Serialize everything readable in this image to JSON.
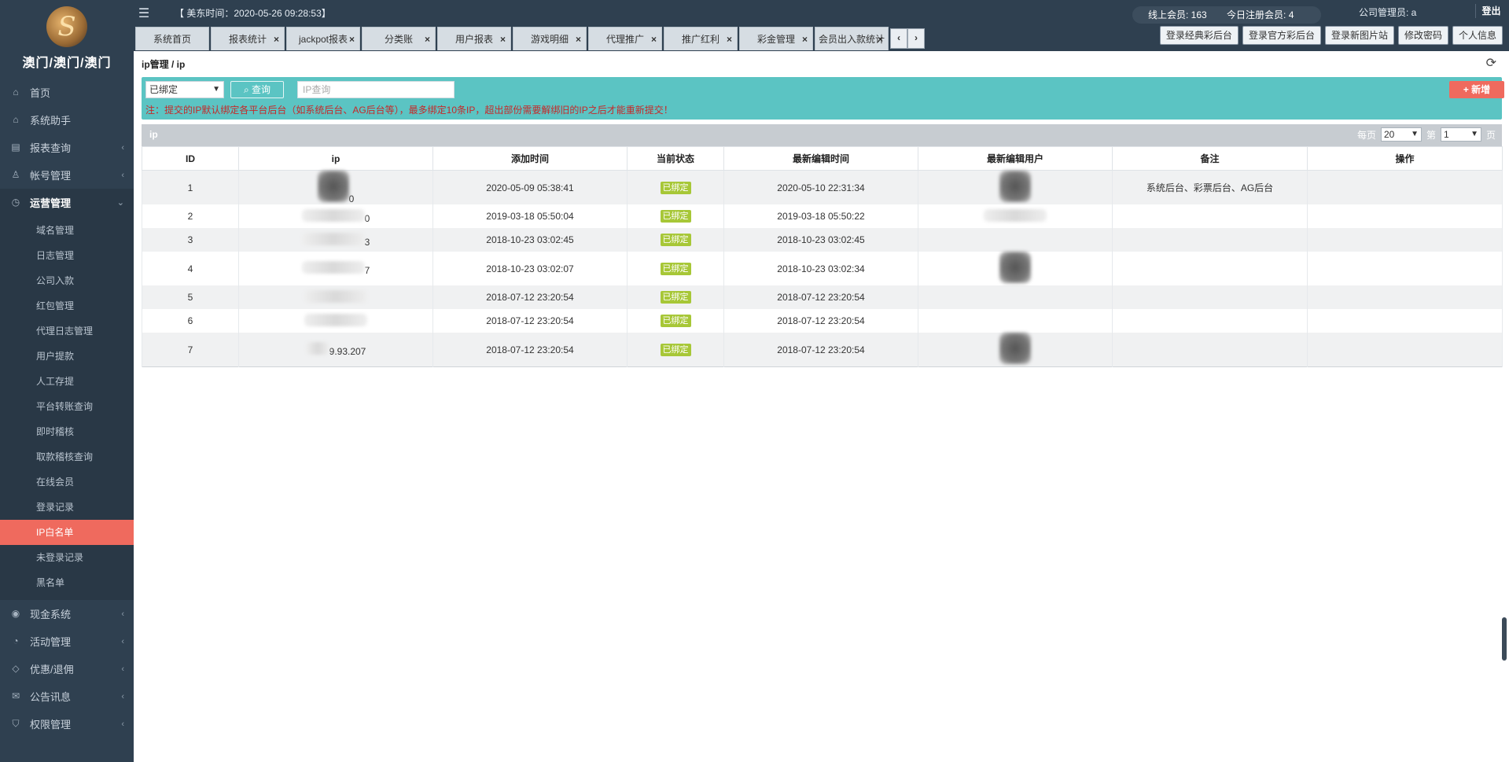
{
  "sidebar": {
    "logo_text": "澳门/澳门/澳门",
    "items": [
      {
        "label": "首页",
        "icon": "home-icon",
        "has_children": false
      },
      {
        "label": "系统助手",
        "icon": "home-icon",
        "has_children": false
      },
      {
        "label": "报表查询",
        "icon": "report-icon",
        "has_children": true
      },
      {
        "label": "帐号管理",
        "icon": "user-icon",
        "has_children": true
      },
      {
        "label": "运营管理",
        "icon": "clock-icon",
        "has_children": true,
        "open": true
      }
    ],
    "sub_items": [
      "域名管理",
      "日志管理",
      "公司入款",
      "红包管理",
      "代理日志管理",
      "用户提款",
      "人工存提",
      "平台转账查询",
      "即时稽核",
      "取款稽核查询",
      "在线会员",
      "登录记录",
      "IP白名单",
      "未登录记录",
      "黑名单"
    ],
    "active_sub": "IP白名单",
    "bottom_items": [
      {
        "label": "现金系统",
        "icon": "coin-icon"
      },
      {
        "label": "活动管理",
        "icon": "pie-icon"
      },
      {
        "label": "优惠/退佣",
        "icon": "tag-icon"
      },
      {
        "label": "公告讯息",
        "icon": "mail-icon"
      },
      {
        "label": "权限管理",
        "icon": "shield-icon"
      }
    ]
  },
  "header": {
    "clock": "【 美东时间：2020-05-26 09:28:53】",
    "online_members": "线上会员: 163",
    "today_registered": "今日注册会员: 4",
    "admin_label": "公司管理员: a",
    "logout": "登出",
    "tabs": [
      {
        "label": "系统首页",
        "closable": false
      },
      {
        "label": "报表统计",
        "closable": true
      },
      {
        "label": "jackpot报表",
        "closable": true
      },
      {
        "label": "分类账",
        "closable": true
      },
      {
        "label": "用户报表",
        "closable": true
      },
      {
        "label": "游戏明细",
        "closable": true
      },
      {
        "label": "代理推广",
        "closable": true
      },
      {
        "label": "推广红利",
        "closable": true
      },
      {
        "label": "彩金管理",
        "closable": true
      },
      {
        "label": "会员出入款统计",
        "closable": true
      }
    ],
    "actions": [
      "登录经典彩后台",
      "登录官方彩后台",
      "登录新图片站",
      "修改密码",
      "个人信息"
    ]
  },
  "main": {
    "breadcrumb": "ip管理 / ip",
    "filter": {
      "status_value": "已绑定",
      "search_label": "查询",
      "ip_placeholder": "IP查询",
      "add_label": "新增",
      "note": "注：提交的IP默认绑定各平台后台（如系统后台、AG后台等），最多绑定10条IP，超出部份需要解绑旧的IP之后才能重新提交！"
    },
    "table": {
      "caption": "ip",
      "per_page_label": "每页",
      "per_page_value": "20",
      "page_label_before": "第",
      "page_value": "1",
      "page_label_after": "页",
      "columns": [
        "ID",
        "ip",
        "添加时间",
        "当前状态",
        "最新编辑时间",
        "最新编辑用户",
        "备注",
        "操作"
      ],
      "rows": [
        {
          "id": "1",
          "ip": "0",
          "added": "2020-05-09 05:38:41",
          "status": "已绑定",
          "edited": "2020-05-10 22:31:34",
          "note": "系统后台、彩票后台、AG后台"
        },
        {
          "id": "2",
          "ip": "0",
          "added": "2019-03-18 05:50:04",
          "status": "已绑定",
          "edited": "2019-03-18 05:50:22",
          "note": ""
        },
        {
          "id": "3",
          "ip": "3",
          "added": "2018-10-23 03:02:45",
          "status": "已绑定",
          "edited": "2018-10-23 03:02:45",
          "note": ""
        },
        {
          "id": "4",
          "ip": "7",
          "added": "2018-10-23 03:02:07",
          "status": "已绑定",
          "edited": "2018-10-23 03:02:34",
          "note": ""
        },
        {
          "id": "5",
          "ip": "",
          "added": "2018-07-12 23:20:54",
          "status": "已绑定",
          "edited": "2018-07-12 23:20:54",
          "note": ""
        },
        {
          "id": "6",
          "ip": "",
          "added": "2018-07-12 23:20:54",
          "status": "已绑定",
          "edited": "2018-07-12 23:20:54",
          "note": ""
        },
        {
          "id": "7",
          "ip": "9.93.207",
          "added": "2018-07-12 23:20:54",
          "status": "已绑定",
          "edited": "2018-07-12 23:20:54",
          "note": ""
        }
      ]
    }
  }
}
